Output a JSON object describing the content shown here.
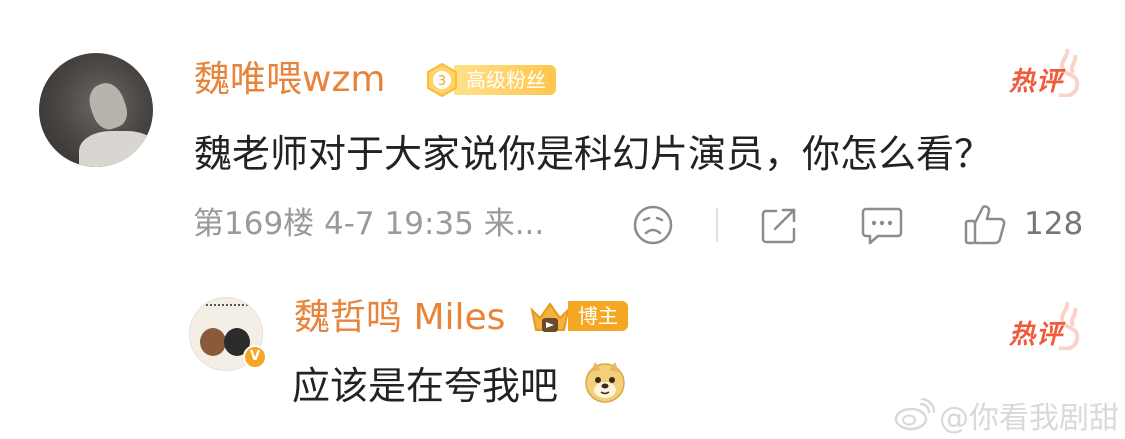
{
  "comment": {
    "author": "魏唯喂wzm",
    "fan_badge": {
      "level": "3",
      "label": "高级粉丝"
    },
    "hot_tag": "热评",
    "text": "魏老师对于大家说你是科幻片演员，你怎么看？",
    "meta": "第169楼  4-7  19:35  来...",
    "likes": "128"
  },
  "reply": {
    "author": "魏哲鸣 Miles",
    "role_badge": "博主",
    "verified_mark": "V",
    "hot_tag": "热评",
    "text": "应该是在夸我吧",
    "emoji": "doge-emoji"
  },
  "watermark": {
    "text": "@你看我剧甜",
    "logo": "weibo-logo-icon"
  },
  "icons": {
    "dislike": "sad-face-icon",
    "share": "share-icon",
    "comment": "comment-icon",
    "like": "thumbs-up-icon"
  },
  "colors": {
    "username": "#e8833a",
    "hot": "#f05b3a",
    "badge_gold": "#ffc64d",
    "meta_gray": "#9a9a9a"
  }
}
